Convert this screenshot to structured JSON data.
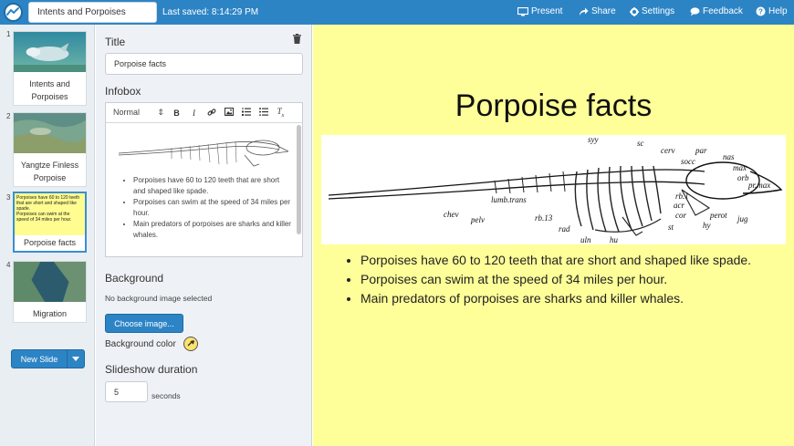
{
  "header": {
    "deck_title": "Intents and Porpoises",
    "saved_text": "Last saved: 8:14:29 PM",
    "nav": {
      "present": "Present",
      "share": "Share",
      "settings": "Settings",
      "feedback": "Feedback",
      "help": "Help"
    }
  },
  "slides": {
    "items": [
      {
        "number": "1",
        "label": "Intents and Porpoises"
      },
      {
        "number": "2",
        "label": "Yangtze Finless Porpoise"
      },
      {
        "number": "3",
        "label": "Porpoise facts"
      },
      {
        "number": "4",
        "label": "Migration"
      }
    ],
    "active_index": 2,
    "thumb3_text": [
      "Porpoises have 60 to 120 teeth that are short and shaped like spade.",
      "Porpoises can swim at the speed of 34 miles per hour."
    ],
    "new_slide_label": "New Slide"
  },
  "editor": {
    "title_heading": "Title",
    "title_value": "Porpoise facts",
    "infobox_heading": "Infobox",
    "format_select": "Normal",
    "toolbar_buttons": {
      "bold": "B",
      "italic": "I",
      "clear": "Tx"
    },
    "bullets": [
      "Porpoises have 60 to 120 teeth that are short and shaped like spade.",
      "Porpoises can swim at the speed of 34 miles per hour.",
      "Main predators of porpoises are sharks and killer whales."
    ],
    "background_heading": "Background",
    "no_bg_text": "No background image selected",
    "choose_image_label": "Choose image...",
    "bg_color_label": "Background color",
    "bg_color": "#fce36a",
    "duration_heading": "Slideshow duration",
    "duration_value": "5",
    "duration_unit": "seconds"
  },
  "preview": {
    "title": "Porpoise facts",
    "background": "#ffff99",
    "bullets": [
      "Porpoises have 60 to 120 teeth that are short and shaped like spade.",
      "Porpoises can swim at the speed of 34 miles per hour.",
      "Main predators of porpoises are sharks and killer whales."
    ],
    "skeleton_labels": [
      "syy",
      "sc",
      "cerv",
      "par",
      "socc",
      "nas",
      "max",
      "orb",
      "pr.max",
      "lumb.trans",
      "chev",
      "pelv",
      "rb.13",
      "rad",
      "uln",
      "hu",
      "rb.1",
      "acr",
      "cor",
      "st",
      "hy",
      "perot",
      "jug"
    ]
  },
  "colors": {
    "topbar": "#2d84c5",
    "accent": "#2d84c5"
  },
  "icons": {
    "logo": "app-logo-icon",
    "present": "monitor-icon",
    "share": "share-arrow-icon",
    "settings": "gear-icon",
    "feedback": "speech-bubble-icon",
    "help": "question-circle-icon",
    "trash": "trash-icon",
    "dropdown": "caret-down-icon"
  }
}
